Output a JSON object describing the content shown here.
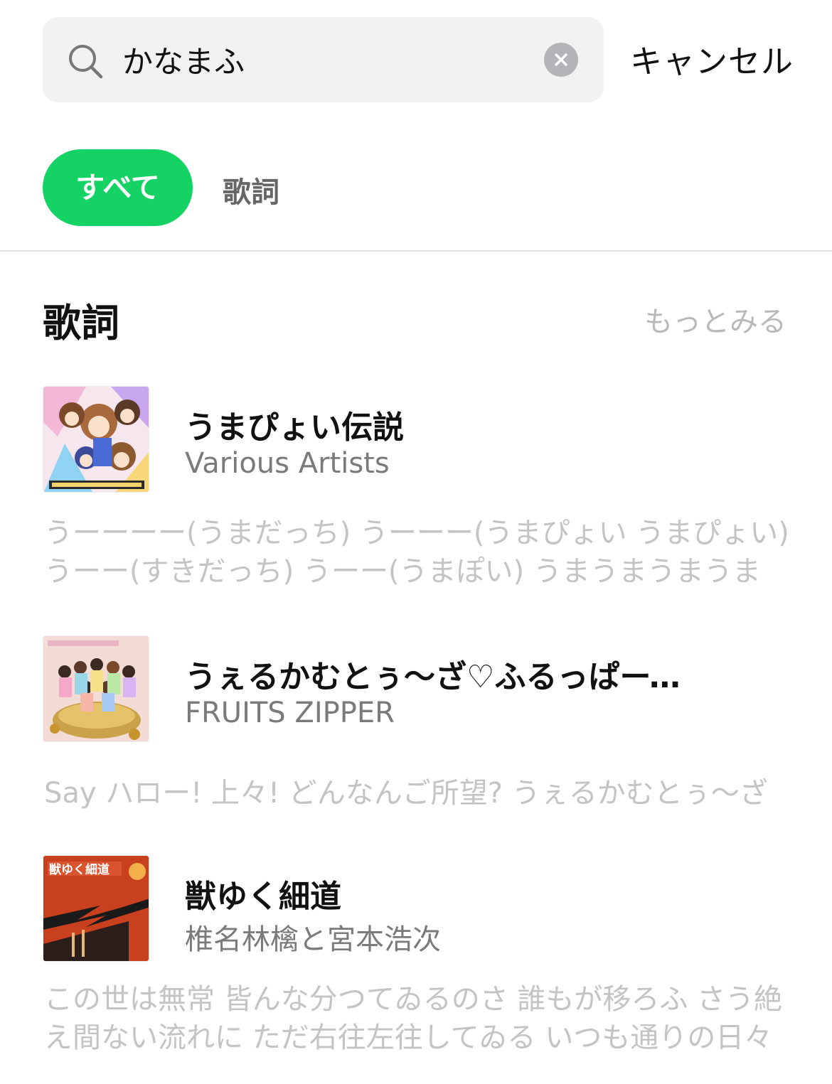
{
  "search": {
    "query": "かなまふ",
    "cancel_label": "キャンセル"
  },
  "tabs": [
    {
      "label": "すべて",
      "active": true
    },
    {
      "label": "歌詞",
      "active": false
    }
  ],
  "section": {
    "title": "歌詞",
    "more_label": "もっとみる"
  },
  "results": [
    {
      "title": "うまぴょい伝説",
      "artist": "Various Artists",
      "snippet": "うーーーー(うまだっち) うーーー(うまぴょい うまぴょい) うーー(すきだっち) うーー(うまぽい) うまうまうまうま",
      "art_icon": "album-art-umapyoi"
    },
    {
      "title": "うぇるかむとぅ〜ざ♡ふるっぱーてぃー",
      "artist": "FRUITS ZIPPER",
      "snippet": "Say ハロー! 上々! どんなんご所望? うぇるかむとぅ〜ざ",
      "art_icon": "album-art-new-kawaii"
    },
    {
      "title": "獣ゆく細道",
      "artist": "椎名林檎と宮本浩次",
      "snippet": "この世は無常 皆んな分つてゐるのさ 誰もが移ろふ さう絶え間ない流れに ただ右往左往してゐる いつも通りの日々",
      "art_icon": "album-art-kemono"
    }
  ],
  "colors": {
    "accent": "#15d265",
    "search_bg": "#f2f2f2",
    "snippet": "#c4c4c4",
    "artist": "#7a7a7a"
  }
}
